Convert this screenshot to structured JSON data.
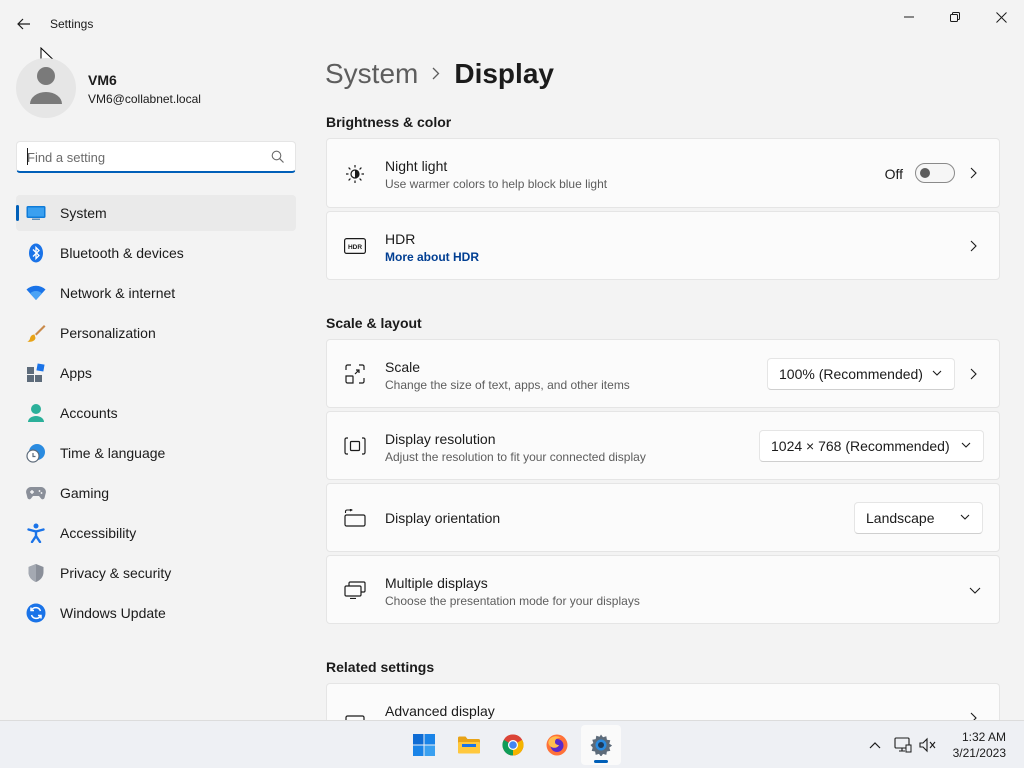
{
  "window": {
    "title": "Settings"
  },
  "user": {
    "name": "VM6",
    "email": "VM6@collabnet.local"
  },
  "search": {
    "placeholder": "Find a setting"
  },
  "nav": {
    "items": [
      {
        "label": "System",
        "icon": "system-icon",
        "selected": true
      },
      {
        "label": "Bluetooth & devices",
        "icon": "bluetooth-icon"
      },
      {
        "label": "Network & internet",
        "icon": "wifi-icon"
      },
      {
        "label": "Personalization",
        "icon": "brush-icon"
      },
      {
        "label": "Apps",
        "icon": "apps-icon"
      },
      {
        "label": "Accounts",
        "icon": "accounts-icon"
      },
      {
        "label": "Time & language",
        "icon": "time-language-icon"
      },
      {
        "label": "Gaming",
        "icon": "gamepad-icon"
      },
      {
        "label": "Accessibility",
        "icon": "accessibility-icon"
      },
      {
        "label": "Privacy & security",
        "icon": "shield-icon"
      },
      {
        "label": "Windows Update",
        "icon": "update-icon"
      }
    ]
  },
  "breadcrumb": {
    "parent": "System",
    "current": "Display"
  },
  "sections": {
    "brightness": "Brightness & color",
    "scale_layout": "Scale & layout",
    "related": "Related settings"
  },
  "night_light": {
    "title": "Night light",
    "subtitle": "Use warmer colors to help block blue light",
    "state": "Off"
  },
  "hdr": {
    "title": "HDR",
    "link": "More about HDR"
  },
  "scale": {
    "title": "Scale",
    "subtitle": "Change the size of text, apps, and other items",
    "value": "100% (Recommended)"
  },
  "resolution": {
    "title": "Display resolution",
    "subtitle": "Adjust the resolution to fit your connected display",
    "value": "1024 × 768 (Recommended)"
  },
  "orientation": {
    "title": "Display orientation",
    "value": "Landscape"
  },
  "multiple_displays": {
    "title": "Multiple displays",
    "subtitle": "Choose the presentation mode for your displays"
  },
  "advanced_display": {
    "title": "Advanced display"
  },
  "taskbar": {
    "apps": [
      "start-icon",
      "file-explorer-icon",
      "chrome-icon",
      "firefox-icon",
      "settings-icon"
    ],
    "time": "1:32 AM",
    "date": "3/21/2023"
  },
  "colors": {
    "accent": "#005fb8",
    "link": "#003e92"
  }
}
